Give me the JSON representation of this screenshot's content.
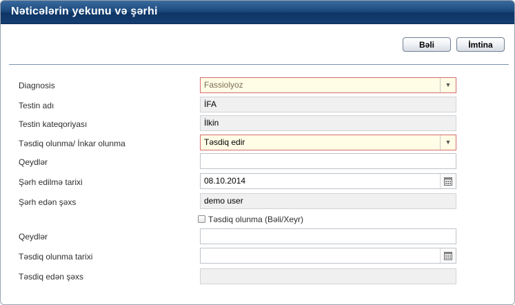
{
  "dialog": {
    "title": "Nəticələrin yekunu və şərhi"
  },
  "toolbar": {
    "yes_label": "Bəli",
    "cancel_label": "İmtina"
  },
  "form": {
    "diagnosis": {
      "label": "Diagnosis",
      "value": "Fassiolyoz"
    },
    "test_name": {
      "label": "Testin adı",
      "value": "İFA"
    },
    "test_category": {
      "label": "Testin kateqoriyası",
      "value": "İlkin"
    },
    "approval_status": {
      "label": "Təsdiq olunma/ İnkar olunma",
      "value": "Təsdiq edir"
    },
    "notes1": {
      "label": "Qeydlər",
      "value": ""
    },
    "comment_date": {
      "label": "Şərh edilmə tarixi",
      "value": "08.10.2014"
    },
    "commenter": {
      "label": "Şərh edən şəxs",
      "value": "demo user"
    },
    "approval_checkbox": {
      "label": "Təsdiq olunma (Bəli/Xeyr)",
      "checked": false
    },
    "notes2": {
      "label": "Qeydlər",
      "value": ""
    },
    "approval_date": {
      "label": "Təsdiq olunma tarixi",
      "value": ""
    },
    "approver": {
      "label": "Təsdiq edən şəxs",
      "value": ""
    }
  },
  "icons": {
    "dropdown": "chevron-down-icon",
    "calendar": "calendar-icon"
  },
  "colors": {
    "titlebar": "#1c4a7e",
    "select_background": "#fffde6",
    "select_border": "#d46b6b",
    "readonly_background": "#f0f0f0"
  }
}
